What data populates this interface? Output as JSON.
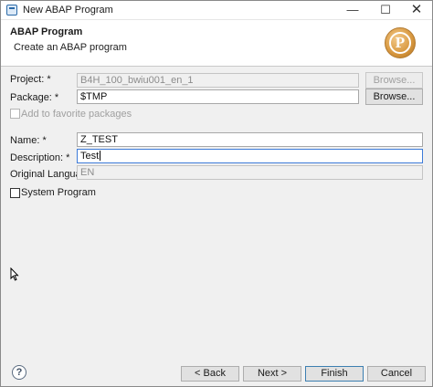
{
  "window": {
    "title": "New ABAP Program",
    "controls": {
      "minimize": "—",
      "maximize": "☐",
      "close": "✕"
    }
  },
  "header": {
    "title": "ABAP Program",
    "subtitle": "Create an ABAP program",
    "icon_letter": "P"
  },
  "form": {
    "project": {
      "label": "Project: *",
      "value": "B4H_100_bwiu001_en_1",
      "button": "Browse..."
    },
    "package": {
      "label": "Package: *",
      "value": "$TMP",
      "button": "Browse..."
    },
    "favorite": {
      "label": "Add to favorite packages"
    },
    "name": {
      "label": "Name: *",
      "value": "Z_TEST"
    },
    "description": {
      "label": "Description: *",
      "value": "Test"
    },
    "original_language": {
      "label": "Original Language:",
      "value": "EN"
    },
    "system_program": {
      "label": "System Program"
    }
  },
  "footer": {
    "help": "?",
    "back": "< Back",
    "next": "Next >",
    "finish": "Finish",
    "cancel": "Cancel"
  },
  "colors": {
    "focus_border": "#3d7bd9",
    "default_button_border": "#3c7fb1",
    "dialog_background": "#f0f0f0"
  }
}
